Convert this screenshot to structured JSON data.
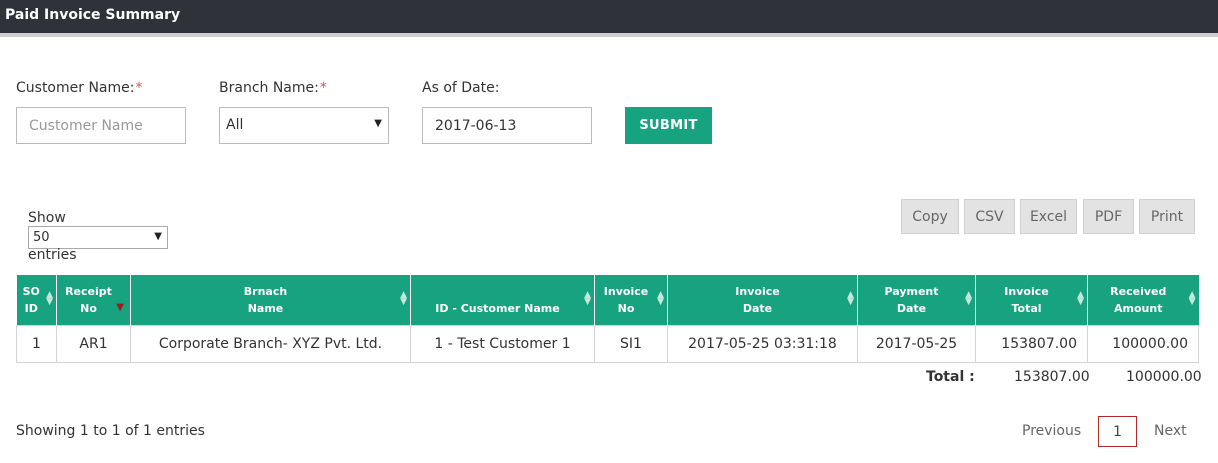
{
  "header": {
    "title": "Paid Invoice Summary"
  },
  "filters": {
    "customer_label": "Customer Name:",
    "branch_label": "Branch Name:",
    "date_label": "As of Date:",
    "required_mark": "*",
    "customer_placeholder": "Customer Name",
    "branch_value": "All",
    "date_value": "2017-06-13",
    "submit_label": "SUBMIT"
  },
  "length": {
    "show": "Show",
    "value": "50",
    "entries": "entries"
  },
  "exports": [
    "Copy",
    "CSV",
    "Excel",
    "PDF",
    "Print"
  ],
  "table": {
    "headers": [
      [
        "SO",
        "ID"
      ],
      [
        "Receipt",
        "No"
      ],
      [
        "Brnach",
        "Name"
      ],
      [
        "",
        "ID - Customer Name"
      ],
      [
        "Invoice",
        "No"
      ],
      [
        "Invoice",
        "Date"
      ],
      [
        "Payment",
        "Date"
      ],
      [
        "Invoice",
        "Total"
      ],
      [
        "Received",
        "Amount"
      ]
    ],
    "rows": [
      [
        "1",
        "AR1",
        "Corporate Branch- XYZ Pvt. Ltd.",
        "1 - Test Customer 1",
        "SI1",
        "2017-05-25 03:31:18",
        "2017-05-25",
        "153807.00",
        "100000.00"
      ]
    ]
  },
  "totals": {
    "label": "Total :",
    "invoice_total": "153807.00",
    "received_amount": "100000.00"
  },
  "footer": {
    "info": "Showing 1 to 1 of 1 entries",
    "previous": "Previous",
    "current_page": "1",
    "next": "Next"
  },
  "colors": {
    "accent": "#17a37f",
    "topbar": "#2f3238",
    "required": "#d9534f"
  },
  "icons": {
    "sort": "sort-both-icon",
    "sort_desc": "sort-desc-icon",
    "caret": "caret-down-icon"
  }
}
